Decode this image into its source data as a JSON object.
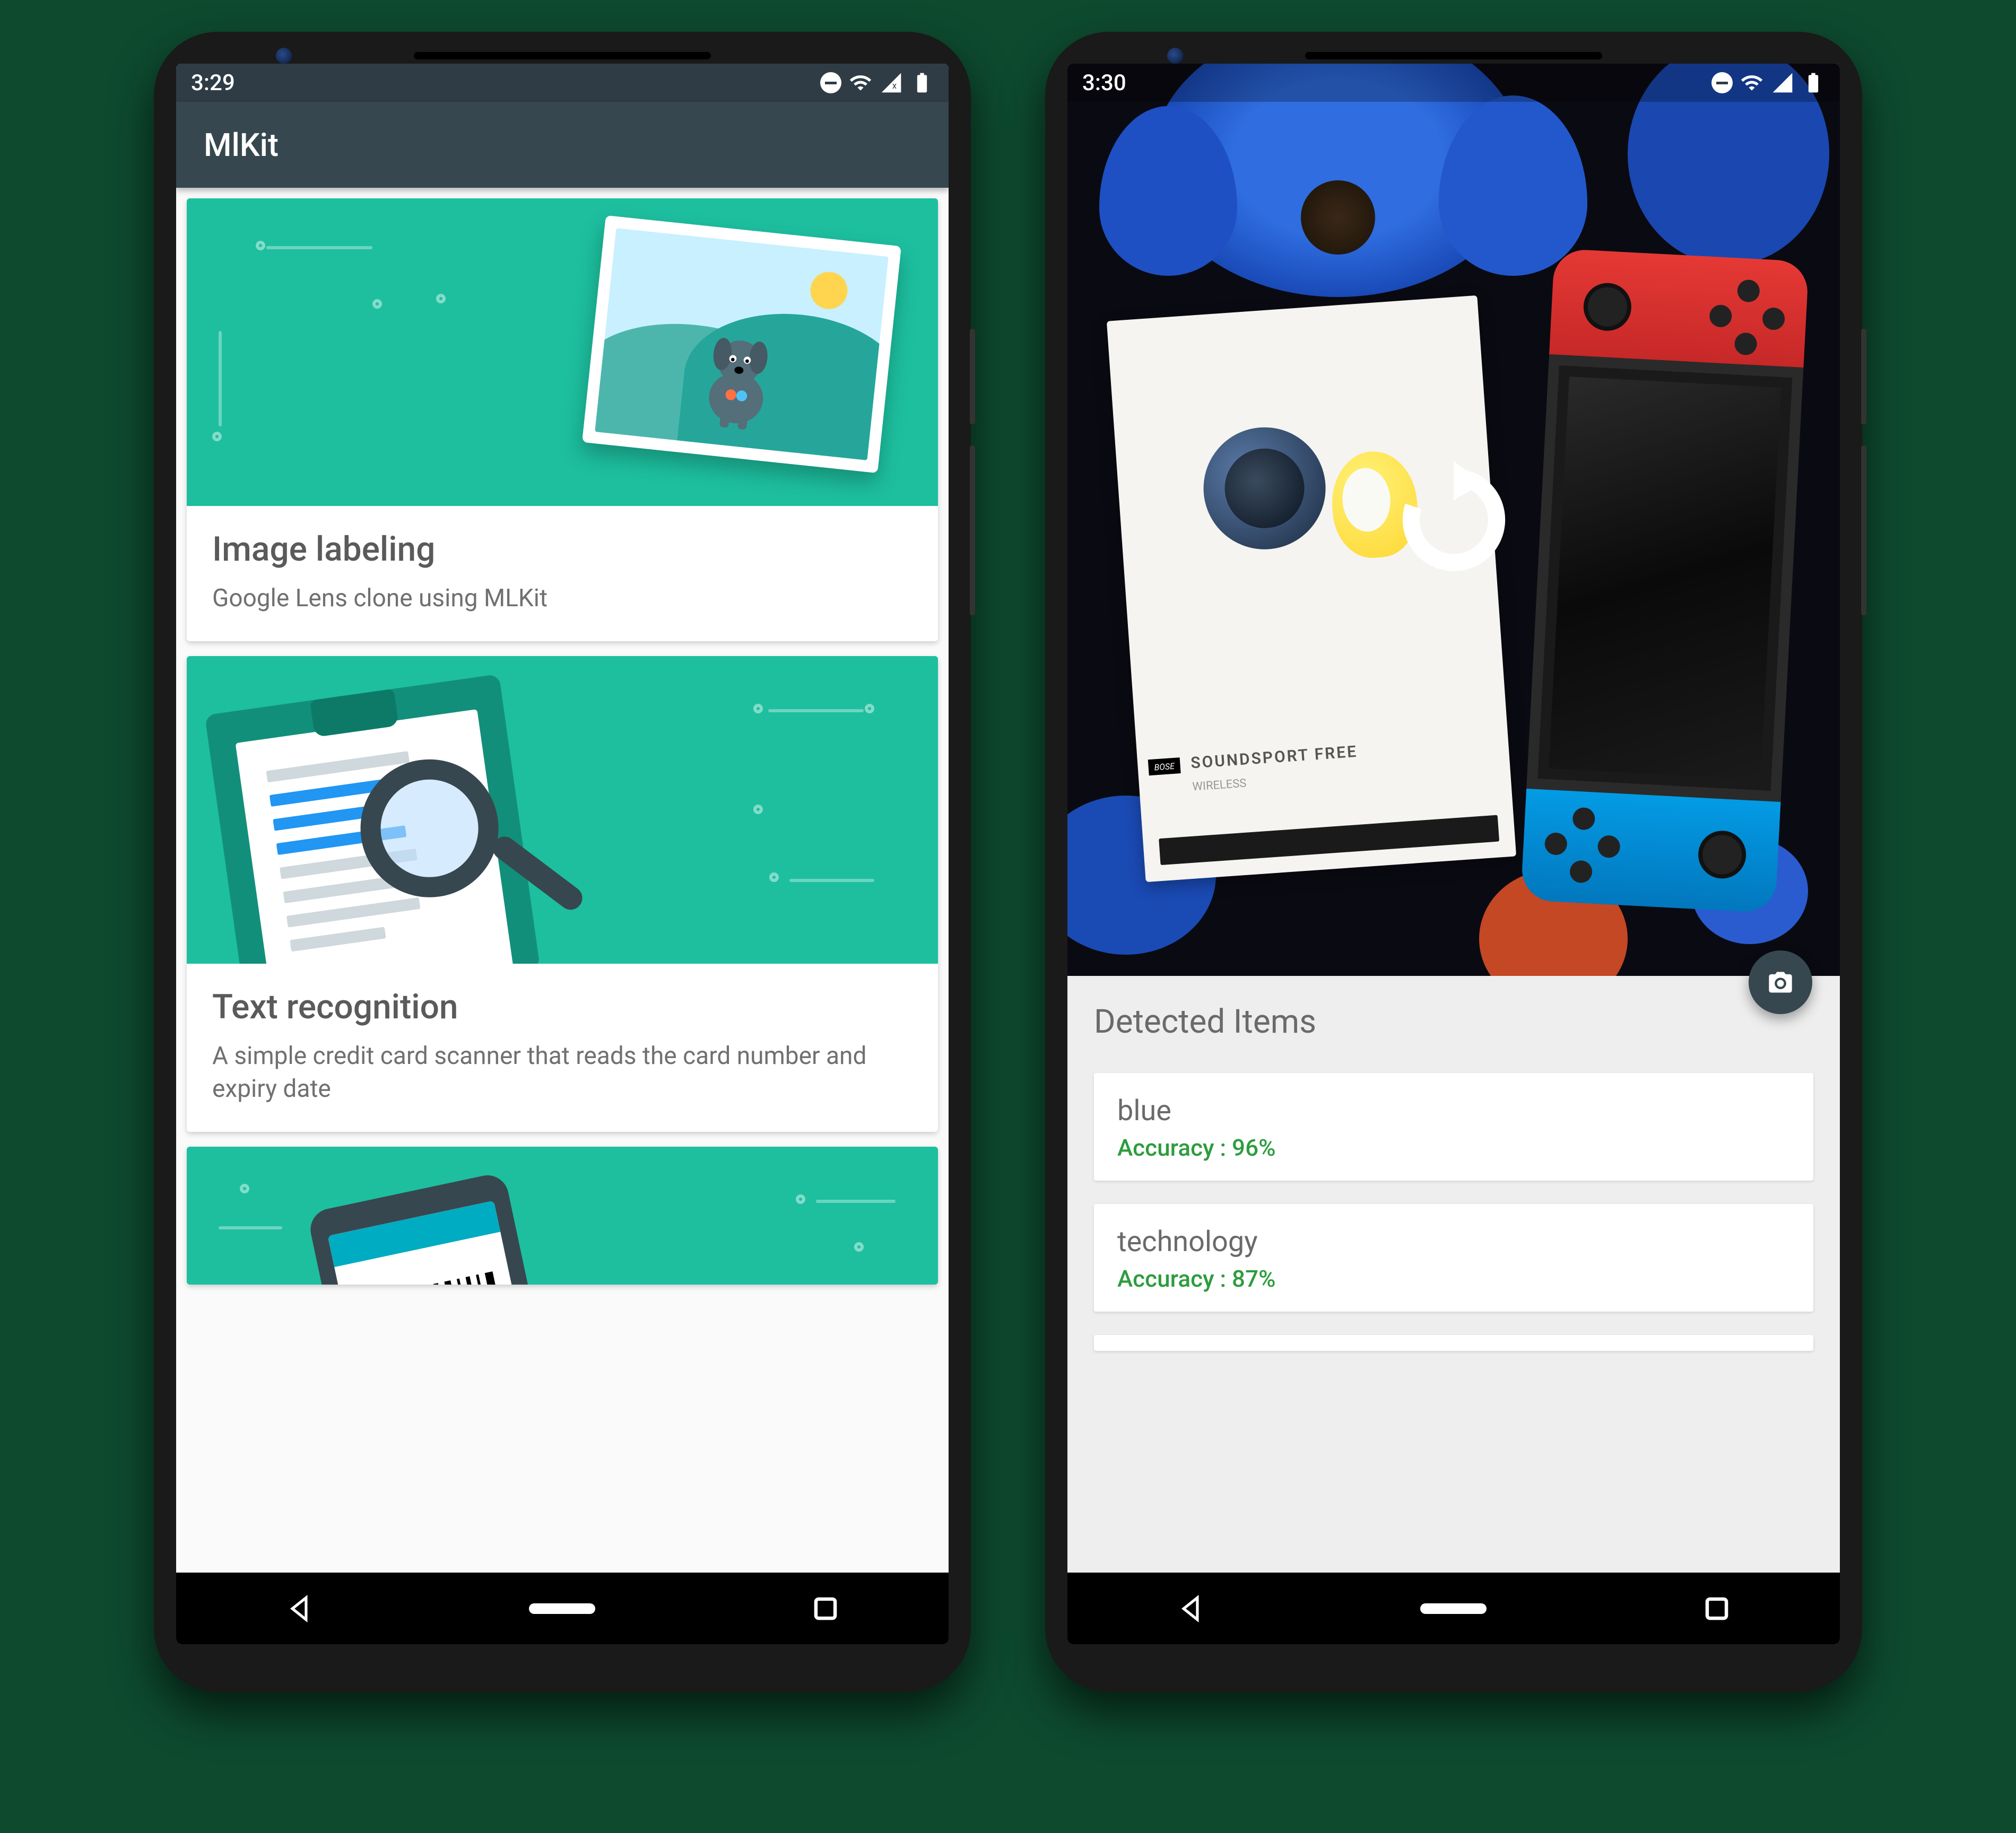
{
  "left": {
    "status_time": "3:29",
    "app_title": "MlKit",
    "cards": [
      {
        "title": "Image labeling",
        "subtitle": "Google Lens clone using MLKit"
      },
      {
        "title": "Text recognition",
        "subtitle": "A simple credit card scanner that reads the card number and expiry date"
      },
      {
        "title": "",
        "subtitle": ""
      }
    ]
  },
  "right": {
    "status_time": "3:30",
    "box_label_main": "SOUNDSPORT FREE",
    "box_label_sub": "WIRELESS",
    "box_brand": "BOSE",
    "results_heading": "Detected Items",
    "results": [
      {
        "label": "blue",
        "accuracy": "Accuracy : 96%"
      },
      {
        "label": "technology",
        "accuracy": "Accuracy : 87%"
      }
    ]
  }
}
